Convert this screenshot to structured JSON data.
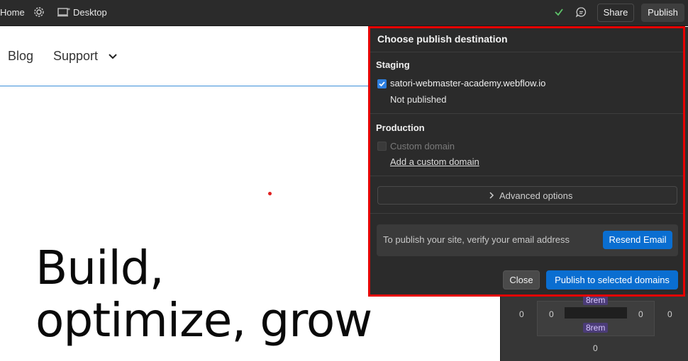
{
  "topbar": {
    "home_label": "Home",
    "desktop_label": "Desktop",
    "share_label": "Share",
    "publish_label": "Publish"
  },
  "site": {
    "nav_blog": "Blog",
    "nav_support": "Support",
    "hero_line1": "Build,",
    "hero_line2": "optimize, grow"
  },
  "spacing": {
    "left_outer": "0",
    "left_inner": "0",
    "right_inner": "0",
    "right_outer": "0",
    "top_rem": "8rem",
    "bottom_rem": "8rem",
    "bottom": "0"
  },
  "popover": {
    "title": "Choose publish destination",
    "staging": {
      "title": "Staging",
      "domain": "satori-webmaster-academy.webflow.io",
      "status": "Not published",
      "checked": true
    },
    "production": {
      "title": "Production",
      "custom_domain": "Custom domain",
      "add_link": "Add a custom domain",
      "checked": false
    },
    "advanced_label": "Advanced options",
    "verify_text": "To publish your site, verify your email address",
    "resend_label": "Resend Email",
    "close_label": "Close",
    "publish_selected_label": "Publish to selected domains"
  },
  "colors": {
    "accent": "#0a6ed1",
    "highlight_border": "#e60000",
    "check_green": "#5ec46a"
  }
}
